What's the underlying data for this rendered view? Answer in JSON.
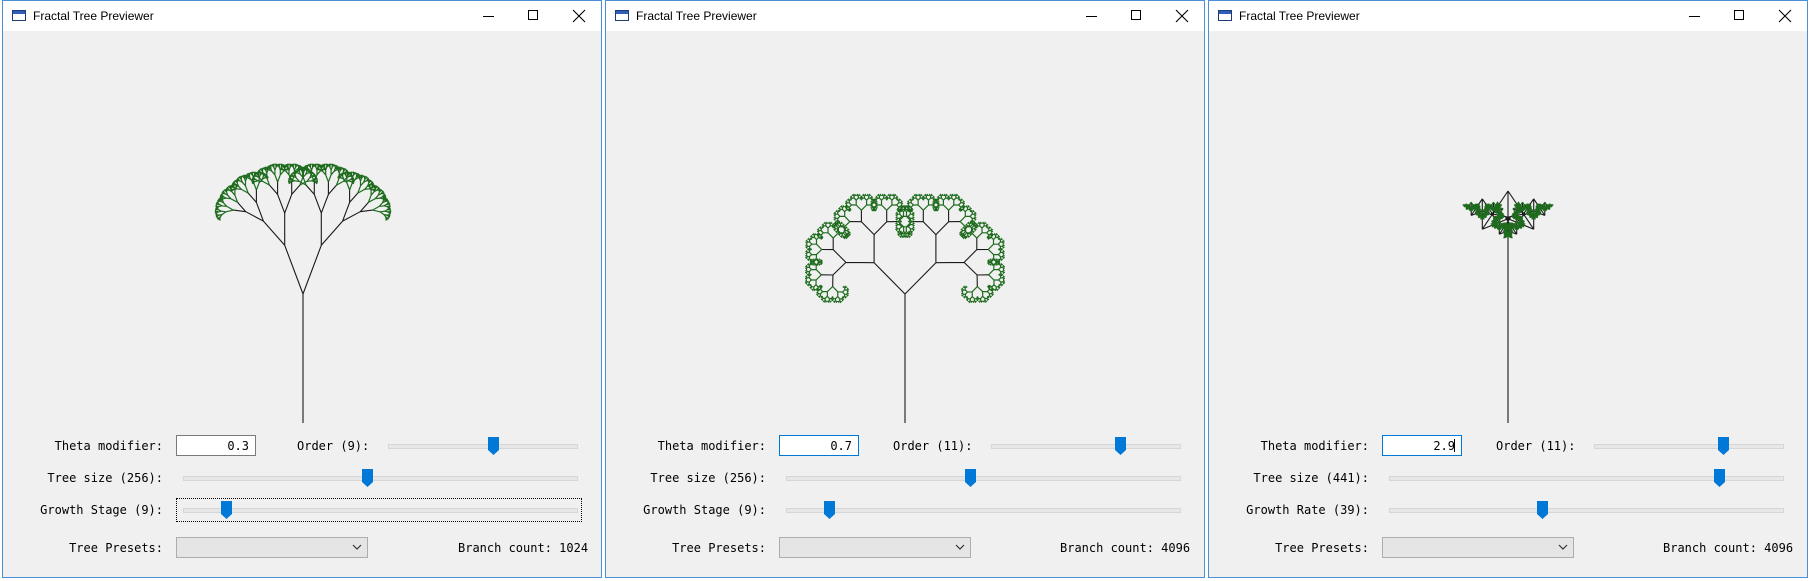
{
  "windows": [
    {
      "title": "Fractal Tree Previewer",
      "theta_label": "Theta modifier:",
      "theta_value": "0.3",
      "order_label": "Order (9):",
      "order_level": 0.56,
      "size_label": "Tree size (256):",
      "size_level": 0.47,
      "growth_label": "Growth Stage (9):",
      "growth_level": 0.11,
      "presets_label": "Tree Presets:",
      "presets_value": "",
      "branch_count": "Branch count: 1024"
    },
    {
      "title": "Fractal Tree Previewer",
      "theta_label": "Theta modifier:",
      "theta_value": "0.7",
      "order_label": "Order (11):",
      "order_level": 0.69,
      "size_label": "Tree size (256):",
      "size_level": 0.47,
      "growth_label": "Growth Stage (9):",
      "growth_level": 0.11,
      "presets_label": "Tree Presets:",
      "presets_value": "",
      "branch_count": "Branch count: 4096"
    },
    {
      "title": "Fractal Tree Previewer",
      "theta_label": "Theta modifier:",
      "theta_value": "2.9",
      "order_label": "Order (11):",
      "order_level": 0.69,
      "size_label": "Tree size (441):",
      "size_level": 0.84,
      "growth_label": "Growth Rate (39):",
      "growth_level": 0.39,
      "presets_label": "Tree Presets:",
      "presets_value": "",
      "branch_count": "Branch count: 4096"
    }
  ],
  "colors": {
    "accent": "#0078d7",
    "window_bg": "#f0f0f0",
    "branch": "#1a1a1a",
    "leaf": "#1e6b1e"
  }
}
